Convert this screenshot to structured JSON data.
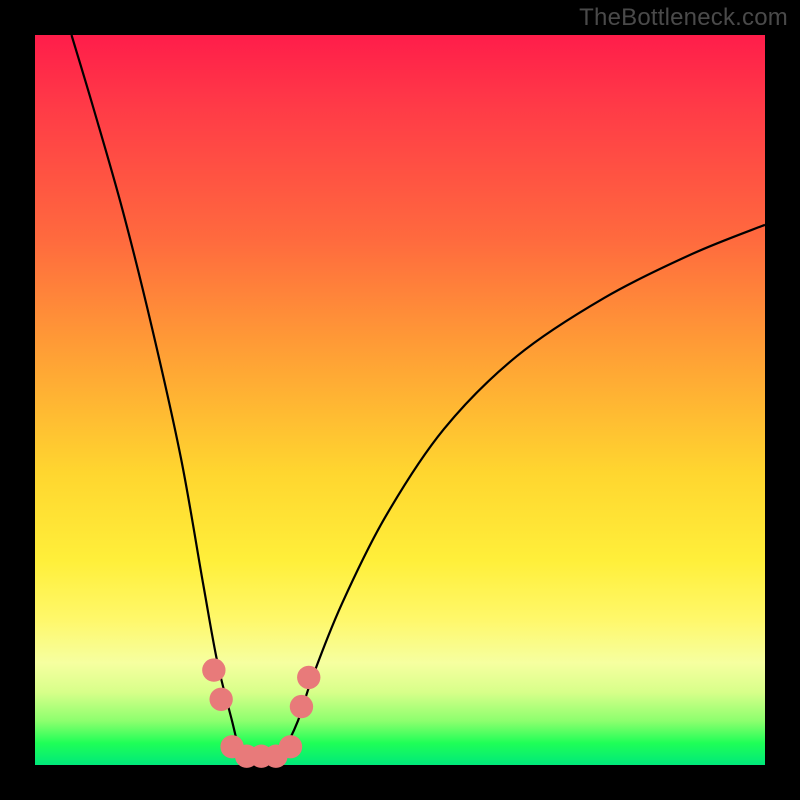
{
  "watermark": "TheBottleneck.com",
  "chart_data": {
    "type": "line",
    "title": "",
    "xlabel": "",
    "ylabel": "",
    "xlim": [
      0,
      100
    ],
    "ylim": [
      0,
      100
    ],
    "gradient_stops": [
      {
        "pos": 0,
        "color": "#ff1d4a"
      },
      {
        "pos": 28,
        "color": "#ff6a3e"
      },
      {
        "pos": 60,
        "color": "#ffd62f"
      },
      {
        "pos": 86,
        "color": "#f6ffa0"
      },
      {
        "pos": 100,
        "color": "#00e87a"
      }
    ],
    "series": [
      {
        "name": "bottleneck-curve",
        "color": "#000000",
        "x": [
          5,
          8,
          12,
          16,
          20,
          23,
          25,
          27,
          28,
          29,
          30,
          32,
          34,
          36,
          38,
          42,
          48,
          56,
          66,
          78,
          90,
          100
        ],
        "values": [
          100,
          90,
          76,
          60,
          42,
          25,
          14,
          6,
          2,
          0,
          0,
          0,
          2,
          6,
          12,
          22,
          34,
          46,
          56,
          64,
          70,
          74
        ]
      }
    ],
    "markers": {
      "name": "bottom-dots",
      "color": "#e87a7a",
      "radius_pct": 1.6,
      "points": [
        {
          "x": 24.5,
          "y": 13
        },
        {
          "x": 25.5,
          "y": 9
        },
        {
          "x": 27.0,
          "y": 2.5
        },
        {
          "x": 29.0,
          "y": 1.2
        },
        {
          "x": 31.0,
          "y": 1.2
        },
        {
          "x": 33.0,
          "y": 1.2
        },
        {
          "x": 35.0,
          "y": 2.5
        },
        {
          "x": 36.5,
          "y": 8
        },
        {
          "x": 37.5,
          "y": 12
        }
      ]
    }
  }
}
